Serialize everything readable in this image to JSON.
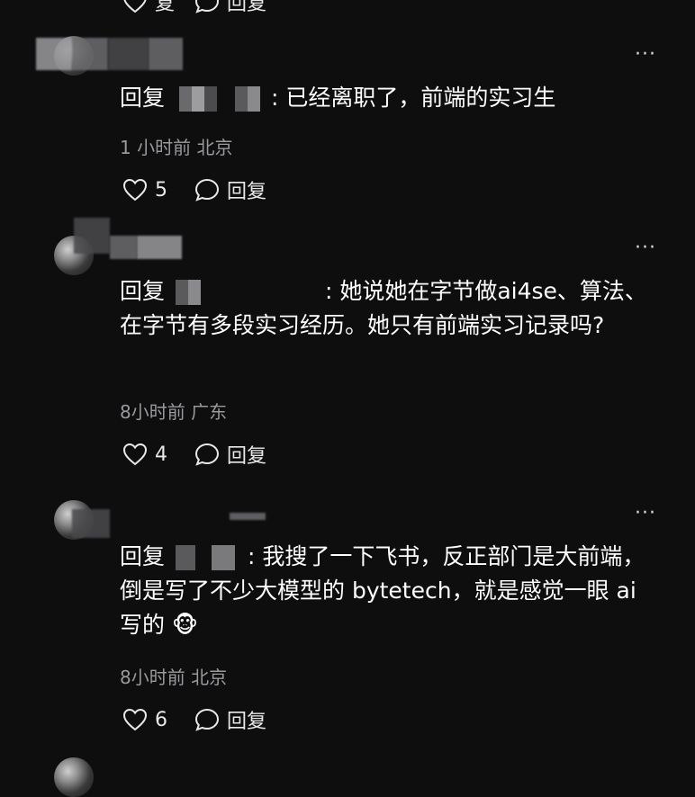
{
  "top_actions": {
    "like_label": "复",
    "reply_label": "回复"
  },
  "comments": [
    {
      "reply_prefix": "回复",
      "reply_to_suffix": "",
      "text": "已经离职了，前端的实习生",
      "time": "1",
      "time_rest": "小时前",
      "location": "北京",
      "likes": "5",
      "reply_label": "回复"
    },
    {
      "reply_prefix": "回复",
      "text": "她说她在字节做ai4se、算法、在字节有多段实习经历。她只有前端实习记录吗?",
      "time": "8小时前",
      "location": "广东",
      "likes": "4",
      "reply_label": "回复"
    },
    {
      "reply_prefix": "回复",
      "text": "我搜了一下飞书，反正部门是大前端，倒是写了不少大模型的 bytetech，就是感觉一眼 ai 写的",
      "emoji": "🐵",
      "time": "8小时前",
      "location": "北京",
      "likes": "6",
      "reply_label": "回复"
    }
  ],
  "more_label": "···",
  "colors": {
    "background": "#0e0e0f",
    "text": "#ffffff",
    "meta": "#9a9a9e"
  }
}
